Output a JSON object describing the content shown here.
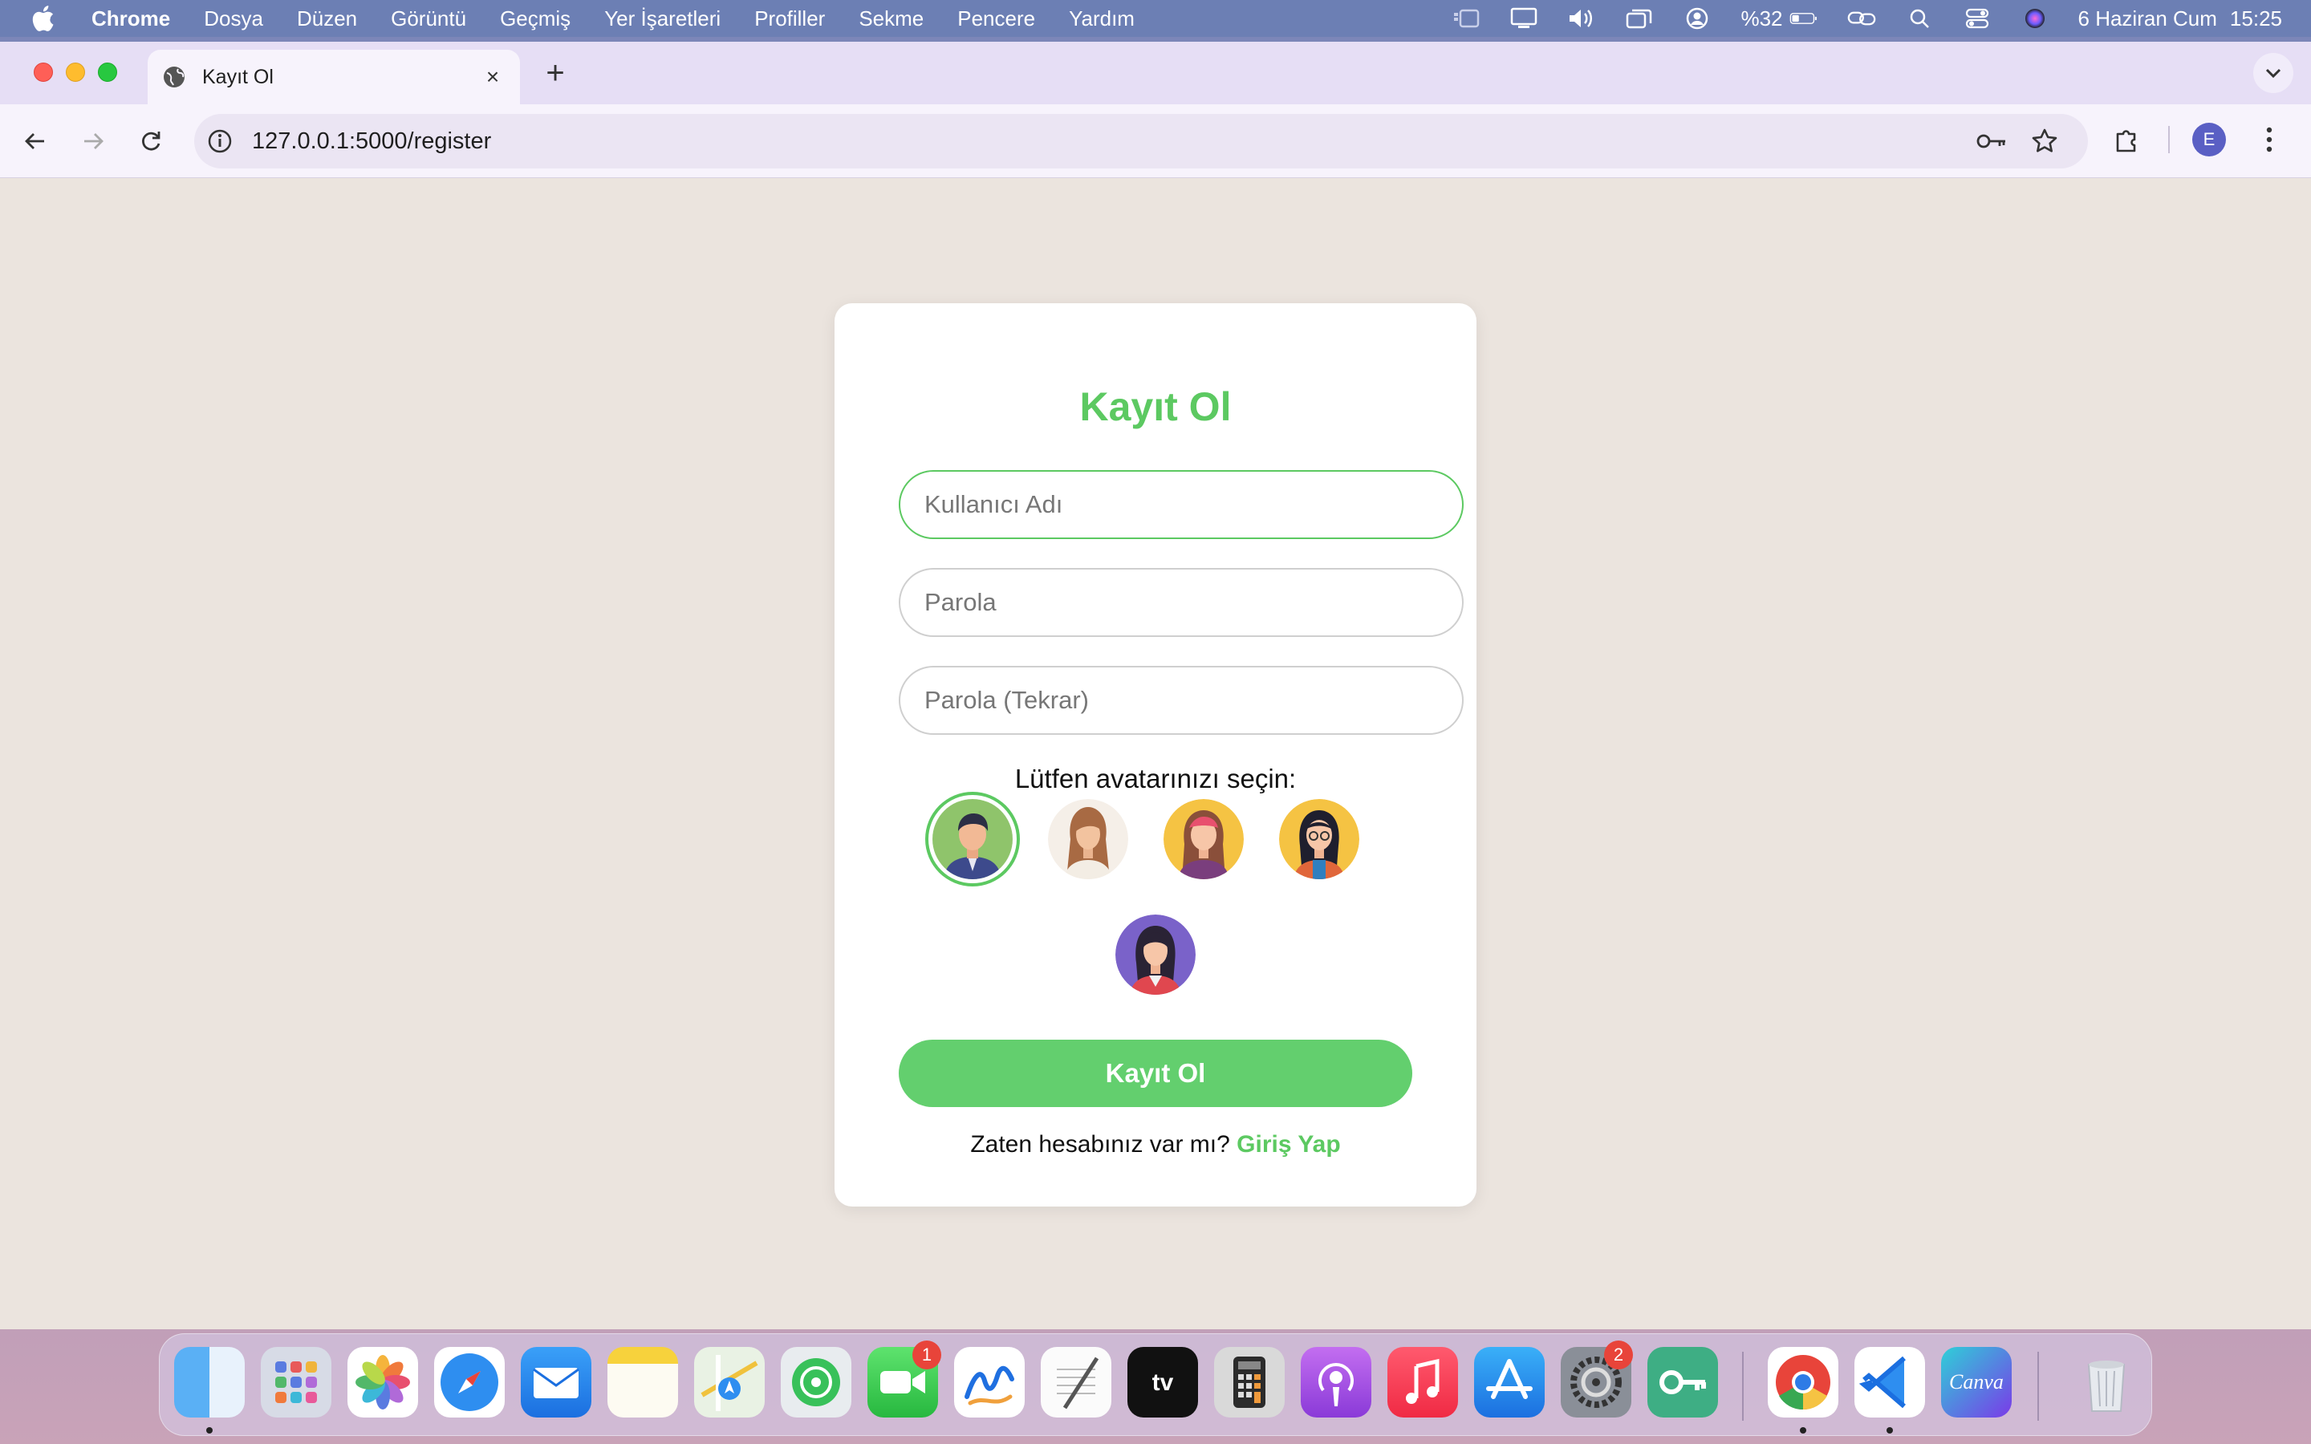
{
  "menubar": {
    "app_name": "Chrome",
    "items": [
      "Dosya",
      "Düzen",
      "Görüntü",
      "Geçmiş",
      "Yer İşaretleri",
      "Profiller",
      "Sekme",
      "Pencere",
      "Yardım"
    ],
    "battery": "%32",
    "date": "6 Haziran Cum",
    "time": "15:25"
  },
  "browser": {
    "tab_title": "Kayıt Ol",
    "url": "127.0.0.1:5000/register",
    "profile_initial": "E"
  },
  "form": {
    "title": "Kayıt Ol",
    "username_placeholder": "Kullanıcı Adı",
    "password_placeholder": "Parola",
    "password_repeat_placeholder": "Parola (Tekrar)",
    "avatar_prompt": "Lütfen avatarınızı seçin:",
    "submit_label": "Kayıt Ol",
    "login_prompt": "Zaten hesabınız var mı?",
    "login_link": "Giriş Yap"
  },
  "dock": {
    "facetime_badge": "1",
    "settings_badge": "2"
  },
  "colors": {
    "accent_green": "#5cc961",
    "page_bg": "#ebe4de"
  }
}
